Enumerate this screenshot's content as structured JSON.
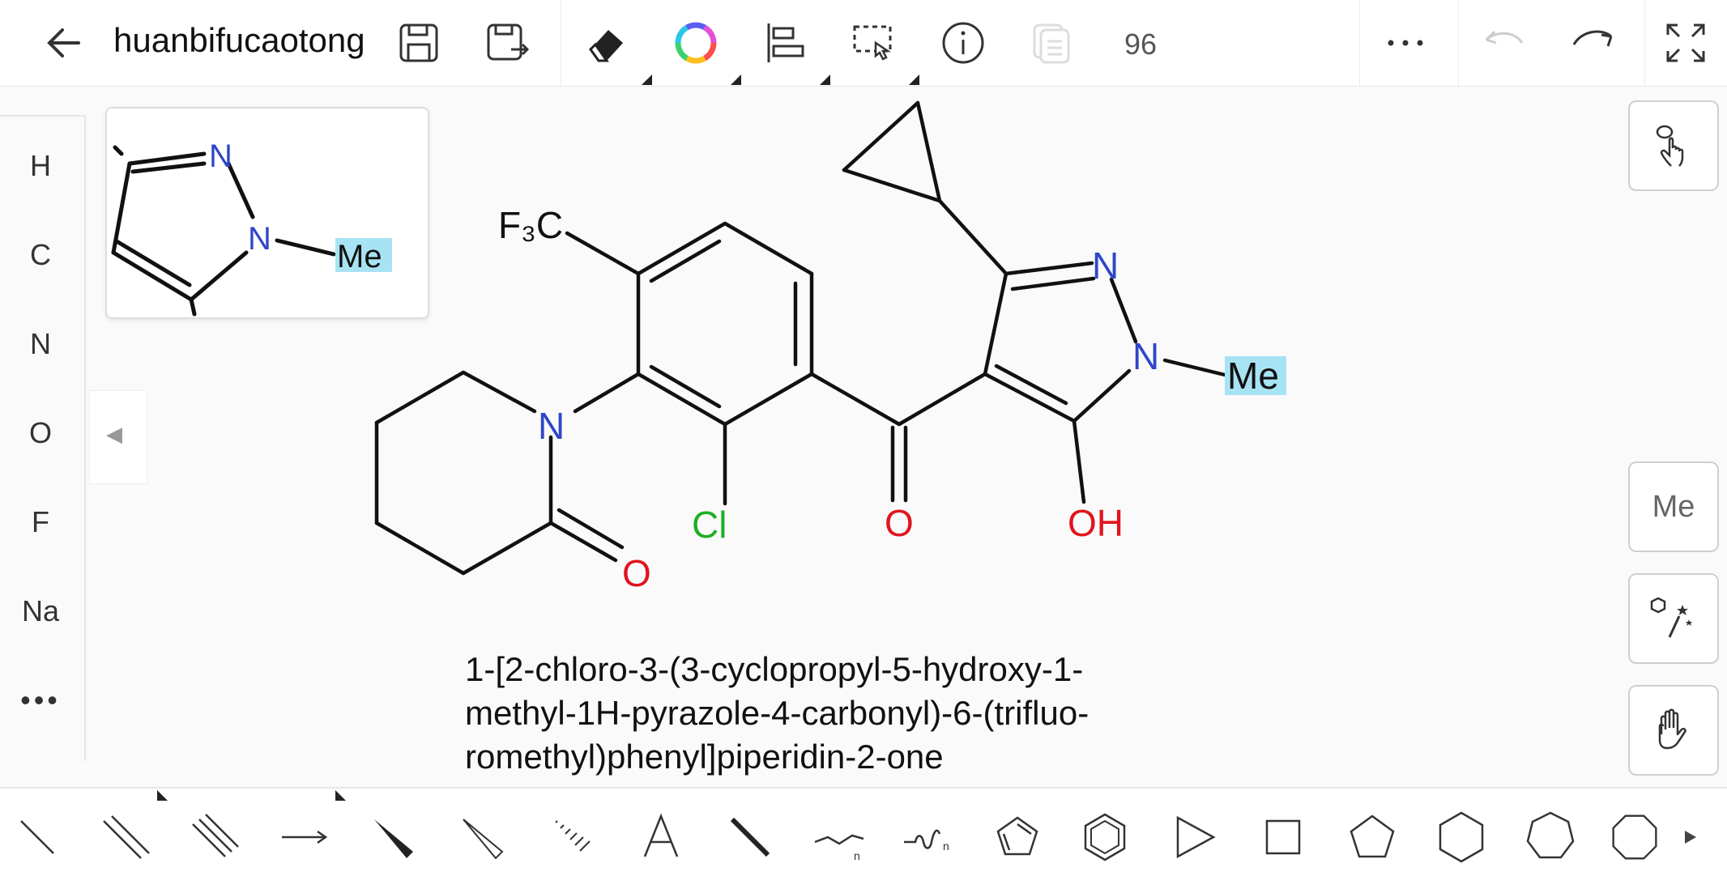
{
  "toolbar": {
    "title": "huanbifucaotong",
    "counter": "96"
  },
  "elements": [
    "H",
    "C",
    "N",
    "O",
    "F",
    "Na",
    "•••"
  ],
  "collapse_glyph": "◀",
  "preview": {
    "atom_n1": "N",
    "atom_n2": "N",
    "atom_me": "Me"
  },
  "molecule": {
    "cf3": "F₃C",
    "n_pip": "N",
    "o_pip": "O",
    "cl": "Cl",
    "o_carbonyl": "O",
    "oh": "OH",
    "n_pz1": "N",
    "n_pz2": "N",
    "me": "Me",
    "colors": {
      "N": "#2f46c8",
      "O": "#e0141e",
      "Cl": "#1fae24",
      "highlight": "#a8e3f4"
    }
  },
  "iupac": {
    "line1": "1-[2-chloro-3-(3-cyclopropyl-5-hydroxy-1-",
    "line2": "methyl-1H-pyrazole-4-carbonyl)-6-(trifluo-",
    "line3": "romethyl)phenyl]piperidin-2-one"
  },
  "right_panel": {
    "me_label": "Me"
  },
  "icons": {
    "top": [
      "back-arrow-icon",
      "save-icon",
      "save-as-icon",
      "eraser-icon",
      "color-wheel-icon",
      "align-icon",
      "select-icon",
      "info-icon",
      "copy-icon",
      "more-icon",
      "undo-icon",
      "redo-icon",
      "fullscreen-icon"
    ],
    "bottom": [
      "single-bond-icon",
      "double-bond-icon",
      "triple-bond-icon",
      "arrow-icon",
      "wedge-bond-icon",
      "hash-wedge-icon",
      "hash-bond-icon",
      "text-icon",
      "bold-bond-icon",
      "chain-icon",
      "wavy-chain-icon",
      "cyclopentadiene-icon",
      "benzene-icon",
      "triangle-icon",
      "square-icon",
      "pentagon-icon",
      "hexagon-icon",
      "heptagon-icon",
      "octagon-icon",
      "scroll-right-icon"
    ]
  }
}
